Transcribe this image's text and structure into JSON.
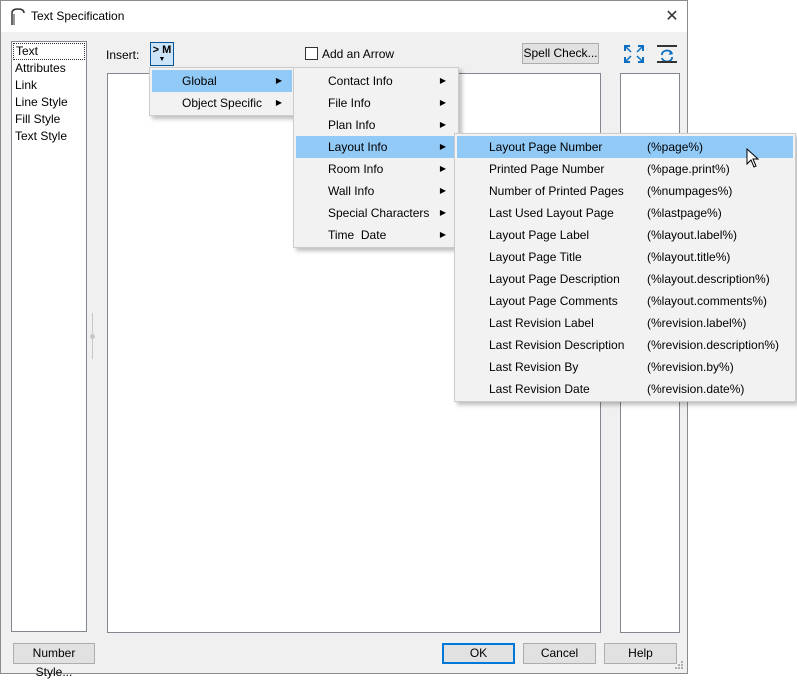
{
  "window": {
    "title": "Text Specification",
    "close_glyph": "✕"
  },
  "nav": {
    "items": [
      {
        "label": "Text",
        "selected": true
      },
      {
        "label": "Attributes"
      },
      {
        "label": "Link"
      },
      {
        "label": "Line Style"
      },
      {
        "label": "Fill Style"
      },
      {
        "label": "Text Style"
      }
    ]
  },
  "toolbar": {
    "insert_label": "Insert:",
    "insert_button": "> M",
    "add_arrow_label": "Add an Arrow",
    "add_arrow_checked": false,
    "spell_check": "Spell Check..."
  },
  "menus": {
    "level1": [
      {
        "label": "Global",
        "highlighted": true
      },
      {
        "label": "Object Specific"
      }
    ],
    "level2": [
      {
        "label": "Contact Info"
      },
      {
        "label": "File Info"
      },
      {
        "label": "Plan Info"
      },
      {
        "label": "Layout Info",
        "highlighted": true
      },
      {
        "label": "Room Info"
      },
      {
        "label": "Wall Info"
      },
      {
        "label": "Special Characters"
      },
      {
        "label": "Time  Date"
      }
    ],
    "level3": [
      {
        "label": "Layout Page Number",
        "value": "(%page%)",
        "highlighted": true
      },
      {
        "label": "Printed Page Number",
        "value": "(%page.print%)"
      },
      {
        "label": "Number of Printed Pages",
        "value": "(%numpages%)"
      },
      {
        "label": "Last Used Layout Page",
        "value": "(%lastpage%)"
      },
      {
        "label": "Layout Page Label",
        "value": "(%layout.label%)"
      },
      {
        "label": "Layout Page Title",
        "value": "(%layout.title%)"
      },
      {
        "label": "Layout Page Description",
        "value": "(%layout.description%)"
      },
      {
        "label": "Layout Page Comments",
        "value": "(%layout.comments%)"
      },
      {
        "label": "Last Revision Label",
        "value": "(%revision.label%)"
      },
      {
        "label": "Last Revision Description",
        "value": "(%revision.description%)"
      },
      {
        "label": "Last Revision By",
        "value": "(%revision.by%)"
      },
      {
        "label": "Last Revision Date",
        "value": "(%revision.date%)"
      }
    ]
  },
  "footer": {
    "number_style": "Number Style...",
    "ok": "OK",
    "cancel": "Cancel",
    "help": "Help"
  },
  "icons": {
    "submenu_arrow": "▶",
    "accent": "#0078d7",
    "highlight": "#91c9f7"
  }
}
